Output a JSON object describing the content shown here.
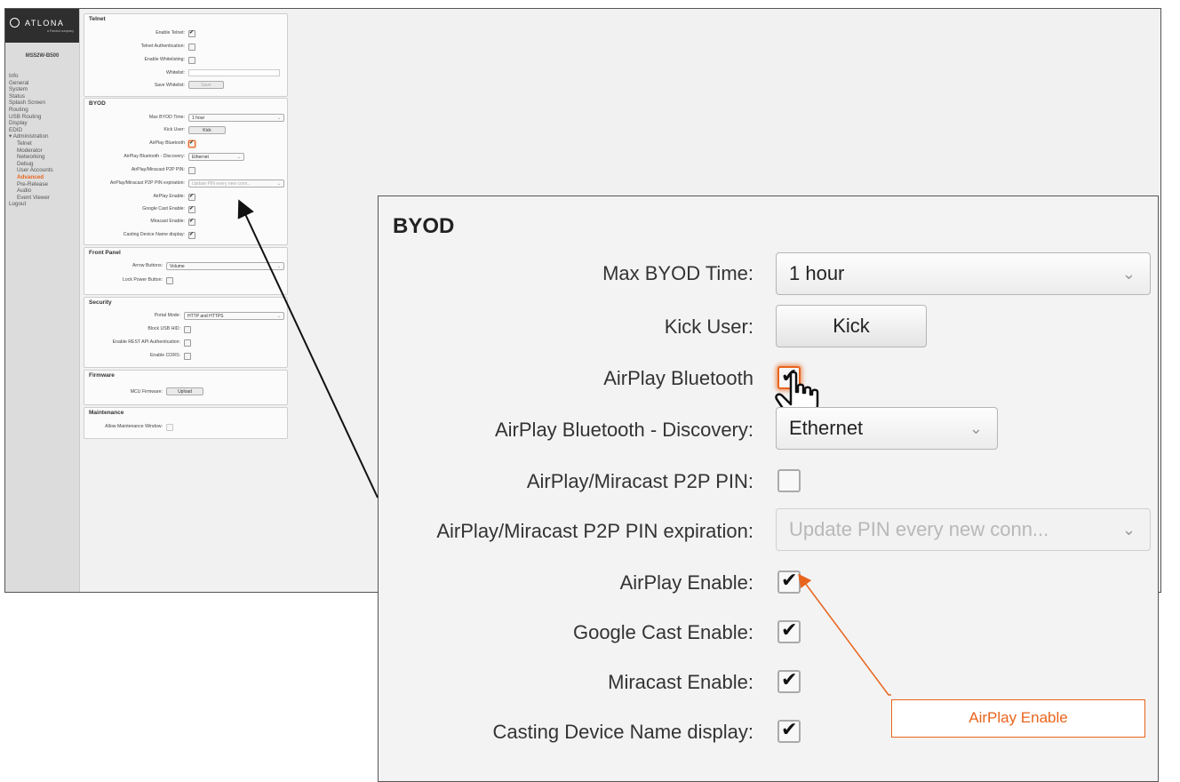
{
  "brand": {
    "logo_text": "ATLONA",
    "logo_sub": "a Panduit company",
    "model": "MS52W-B500"
  },
  "nav": [
    {
      "label": "Info",
      "level": "top"
    },
    {
      "label": "General",
      "level": "top"
    },
    {
      "label": "System",
      "level": "top"
    },
    {
      "label": "Status",
      "level": "top"
    },
    {
      "label": "Splash Screen",
      "level": "top"
    },
    {
      "label": "Routing",
      "level": "top"
    },
    {
      "label": "USB Routing",
      "level": "top"
    },
    {
      "label": "Display",
      "level": "top"
    },
    {
      "label": "EDID",
      "level": "top"
    },
    {
      "label": "▾ Administration",
      "level": "top"
    },
    {
      "label": "Telnet",
      "level": "sub"
    },
    {
      "label": "Moderator",
      "level": "sub"
    },
    {
      "label": "Networking",
      "level": "sub"
    },
    {
      "label": "Debug",
      "level": "sub"
    },
    {
      "label": "User Accounts",
      "level": "sub"
    },
    {
      "label": "Advanced",
      "level": "sub",
      "active": true
    },
    {
      "label": "Pre-Release",
      "level": "sub"
    },
    {
      "label": "Audio",
      "level": "sub"
    },
    {
      "label": "Event Viewer",
      "level": "sub"
    },
    {
      "label": "Logout",
      "level": "top"
    }
  ],
  "telnet": {
    "title": "Telnet",
    "enable_telnet": "Enable Telnet:",
    "telnet_auth": "Telnet Authentication:",
    "enable_whitelisting": "Enable Whitelisting:",
    "whitelist": "Whitelist:",
    "save_whitelist": "Save Whitelist:",
    "save_button": "Save"
  },
  "byod": {
    "title": "BYOD",
    "max_time_label": "Max BYOD Time:",
    "max_time_value": "1 hour",
    "kick_user_label": "Kick User:",
    "kick_button": "Kick",
    "airplay_bt_label": "AirPlay Bluetooth",
    "airplay_bt_discovery_label": "AirPlay Bluetooth - Discovery:",
    "airplay_bt_discovery_value": "Ethernet",
    "p2p_pin_label": "AirPlay/Miracast P2P PIN:",
    "p2p_exp_label": "AirPlay/Miracast P2P PIN expiration:",
    "p2p_exp_value": "Update PIN every new conn...",
    "airplay_enable_label": "AirPlay Enable:",
    "google_cast_label": "Google Cast Enable:",
    "miracast_label": "Miracast Enable:",
    "casting_name_label": "Casting Device Name display:"
  },
  "front_panel": {
    "title": "Front Panel",
    "arrow_buttons_label": "Arrow Buttons:",
    "arrow_buttons_value": "Volume",
    "lock_power_label": "Lock Power Button:"
  },
  "security": {
    "title": "Security",
    "portal_mode_label": "Portal Mode:",
    "portal_mode_value": "HTTP and HTTPS",
    "block_usb_label": "Block USB HID:",
    "rest_api_label": "Enable REST API Authentication:",
    "cors_label": "Enable CORS:"
  },
  "firmware": {
    "title": "Firmware",
    "mcu_label": "MCU Firmware:",
    "upload_button": "Upload"
  },
  "maintenance": {
    "title": "Maintenance",
    "allow_window_label": "Allow Maintenance Window:"
  },
  "callout": {
    "label": "AirPlay Enable"
  },
  "colors": {
    "accent": "#e8641c",
    "sidebar_bg": "#dcdcdc",
    "logo_bg": "#2e2e2e"
  }
}
